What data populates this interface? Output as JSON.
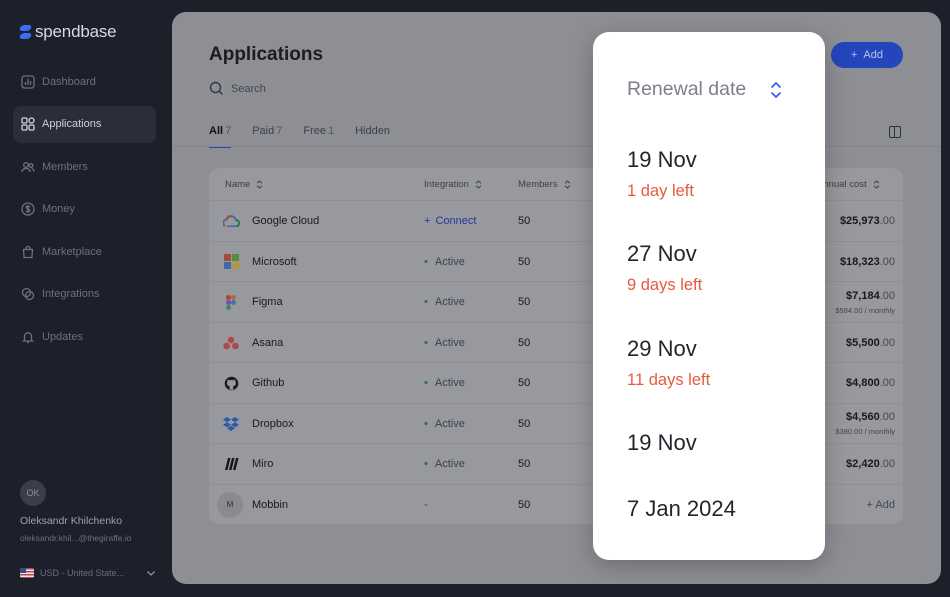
{
  "brand": {
    "name": "spendbase"
  },
  "sidebar": {
    "items": [
      {
        "label": "Dashboard",
        "icon": "chart-icon"
      },
      {
        "label": "Applications",
        "icon": "grid-icon",
        "active": true
      },
      {
        "label": "Members",
        "icon": "users-icon"
      },
      {
        "label": "Money",
        "icon": "dollar-icon"
      },
      {
        "label": "Marketplace",
        "icon": "bag-icon"
      },
      {
        "label": "Integrations",
        "icon": "link-icon"
      },
      {
        "label": "Updates",
        "icon": "bell-icon"
      }
    ],
    "profile": {
      "initials": "OK",
      "name": "Oleksandr Khilchenko",
      "email": "oleksandr.khil...@thegiraffe.io"
    },
    "currency": "USD - United State..."
  },
  "main": {
    "title": "Applications",
    "search_placeholder": "Search",
    "add_label": "Add",
    "tabs": [
      {
        "label": "All",
        "count": "7",
        "active": true
      },
      {
        "label": "Paid",
        "count": "7"
      },
      {
        "label": "Free",
        "count": "1"
      },
      {
        "label": "Hidden",
        "count": ""
      }
    ],
    "table": {
      "headers": {
        "name": "Name",
        "integration": "Integration",
        "members": "Members",
        "cost": "Annual cost"
      },
      "rows": [
        {
          "name": "Google Cloud",
          "icon": "google-cloud-icon",
          "integration": "Connect",
          "status": "connect",
          "members": "50",
          "cost_main": "$25,973",
          "cost_dec": ".00",
          "cost_sub": ""
        },
        {
          "name": "Microsoft",
          "icon": "microsoft-icon",
          "integration": "Active",
          "status": "active",
          "members": "50",
          "cost_main": "$18,323",
          "cost_dec": ".00",
          "cost_sub": ""
        },
        {
          "name": "Figma",
          "icon": "figma-icon",
          "integration": "Active",
          "status": "active",
          "members": "50",
          "cost_main": "$7,184",
          "cost_dec": ".00",
          "cost_sub": "$584.00 / monthly"
        },
        {
          "name": "Asana",
          "icon": "asana-icon",
          "integration": "Active",
          "status": "active",
          "members": "50",
          "cost_main": "$5,500",
          "cost_dec": ".00",
          "cost_sub": ""
        },
        {
          "name": "Github",
          "icon": "github-icon",
          "integration": "Active",
          "status": "active",
          "members": "50",
          "cost_main": "$4,800",
          "cost_dec": ".00",
          "cost_sub": ""
        },
        {
          "name": "Dropbox",
          "icon": "dropbox-icon",
          "integration": "Active",
          "status": "active",
          "members": "50",
          "cost_main": "$4,560",
          "cost_dec": ".00",
          "cost_sub": "$380.00 / monthly"
        },
        {
          "name": "Miro",
          "icon": "miro-icon",
          "integration": "Active",
          "status": "active",
          "members": "50",
          "cost_main": "$2,420",
          "cost_dec": ".00",
          "cost_sub": ""
        },
        {
          "name": "Mobbin",
          "icon": "mobbin-icon",
          "initial": "M",
          "integration": "-",
          "status": "none",
          "members": "50",
          "cost_main": "+ Add",
          "cost_dec": "",
          "cost_sub": ""
        }
      ]
    }
  },
  "renewal_popup": {
    "header": "Renewal date",
    "entries": [
      {
        "date": "19 Nov",
        "left": "1 day left"
      },
      {
        "date": "27 Nov",
        "left": "9 days left"
      },
      {
        "date": "29 Nov",
        "left": "11 days left"
      },
      {
        "date": "19 Nov",
        "left": ""
      },
      {
        "date": "7 Jan 2024",
        "left": ""
      }
    ]
  },
  "colors": {
    "accent": "#3b6cf6",
    "warning": "#e65a3c",
    "active": "#236e42"
  }
}
